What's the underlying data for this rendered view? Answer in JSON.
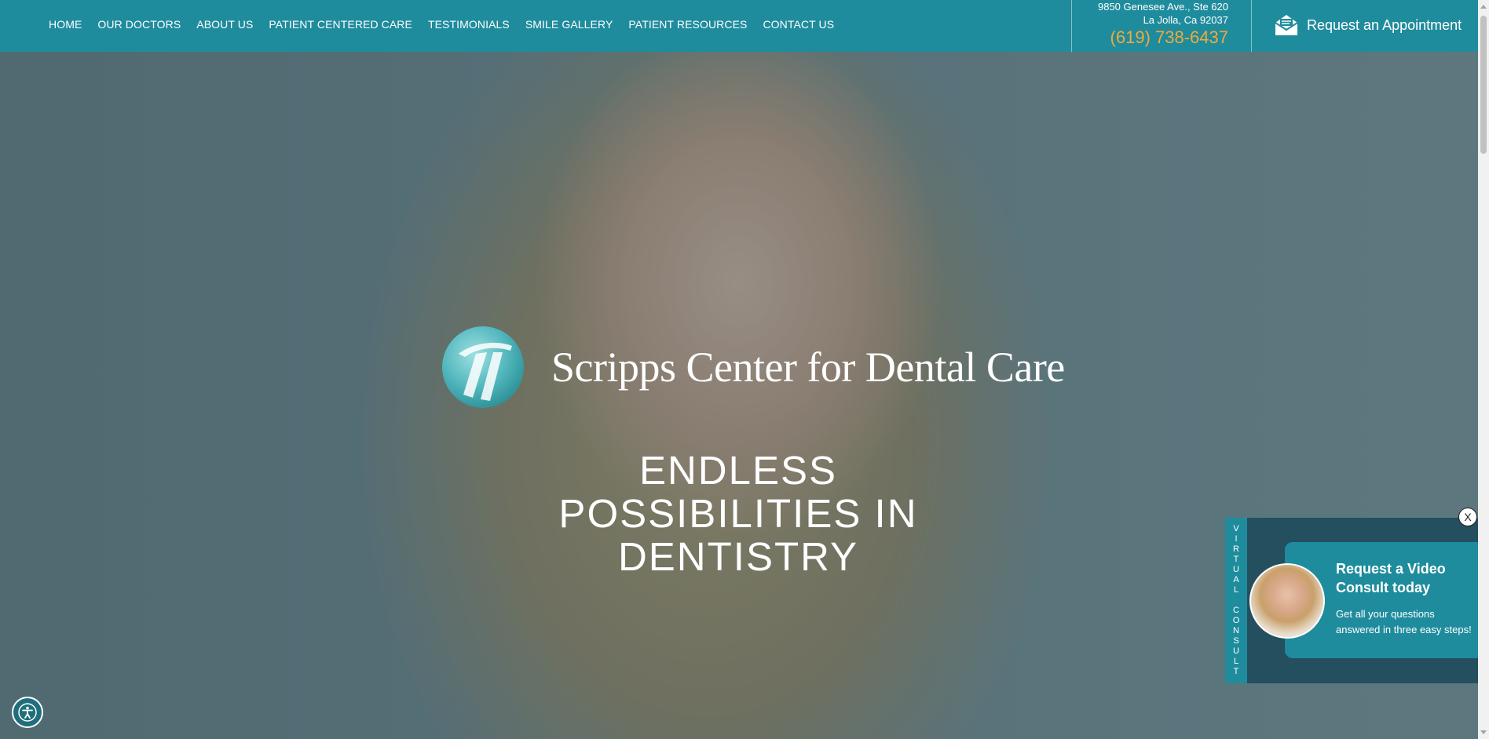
{
  "nav": {
    "items": [
      {
        "label": "HOME"
      },
      {
        "label": "OUR DOCTORS"
      },
      {
        "label": "ABOUT US"
      },
      {
        "label": "PATIENT CENTERED CARE"
      },
      {
        "label": "TESTIMONIALS"
      },
      {
        "label": "SMILE GALLERY"
      },
      {
        "label": "PATIENT RESOURCES"
      },
      {
        "label": "CONTACT US"
      }
    ]
  },
  "contact": {
    "address_line1": "9850 Genesee Ave., Ste 620",
    "address_line2": "La Jolla, Ca 92037",
    "phone": "(619) 738-6437",
    "appointment_label": "Request an Appointment",
    "appointment_icon": "envelope-icon"
  },
  "hero": {
    "brand_name": "Scripps Center for Dental Care",
    "headline_lines": [
      "ENDLESS",
      "POSSIBILITIES IN",
      "DENTISTRY"
    ]
  },
  "consult_popup": {
    "tab_letters": [
      "V",
      "I",
      "R",
      "T",
      "U",
      "A",
      "L",
      " ",
      "C",
      "O",
      "N",
      "S",
      "U",
      "L",
      "T"
    ],
    "title": "Request a Video Consult today",
    "subtitle": "Get all your questions answered in three easy steps!",
    "close_label": "X"
  },
  "colors": {
    "primary_teal": "#1f8c9d",
    "phone_orange": "#f2a93b",
    "popup_dark": "#234f5f"
  },
  "icons": {
    "accessibility": "accessibility-icon",
    "logo": "logo-mark-icon"
  }
}
